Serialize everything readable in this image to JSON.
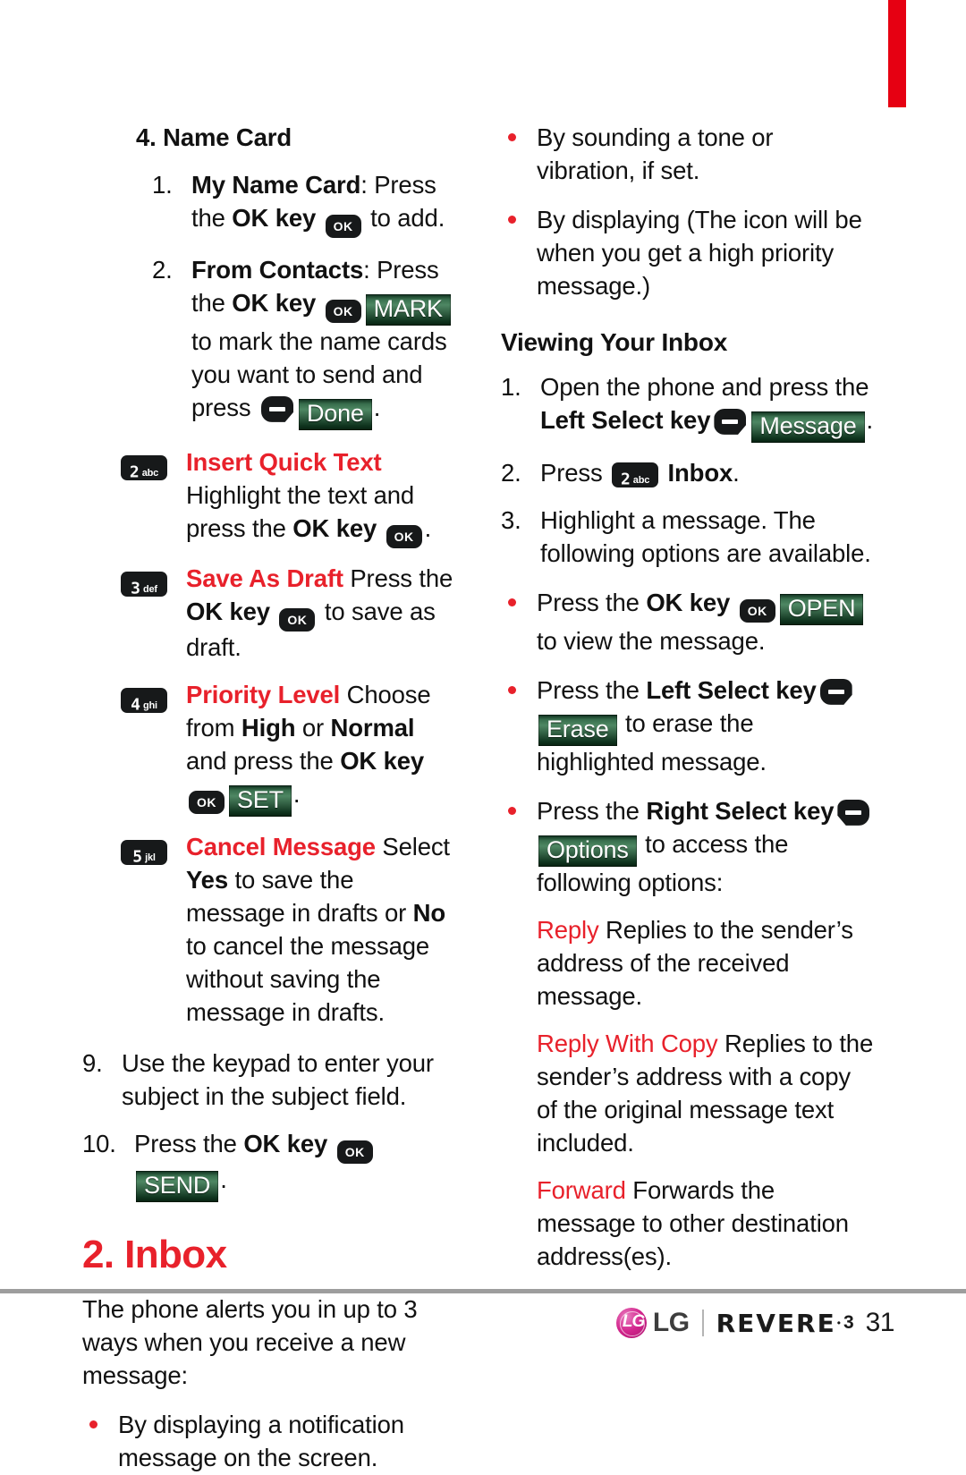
{
  "page": {
    "number": "31",
    "accent_red": "#e8212b",
    "tab_red": "#e60012",
    "green_button": "#2e5b3f"
  },
  "left_column": {
    "heading": "4. Name Card",
    "step1": {
      "marker": "1.",
      "term": "My Name Card",
      "text_a": ": Press the ",
      "term_b": "OK key",
      "key": "ok",
      "text_b": " to add."
    },
    "step2": {
      "marker": "2.",
      "term": "From Contacts",
      "text_a": ": Press the ",
      "term_b": "OK key",
      "key": "ok",
      "button": "MARK",
      "text_b": " to mark the name cards you want to send and press ",
      "softkey": "left-select",
      "button2": "Done",
      "text_c": "."
    },
    "keyed_items": [
      {
        "key_digit": "2",
        "key_letters": "abc",
        "title": "Insert Quick Text",
        "body_a": "Highlight the text and press the ",
        "bold_b": "OK key",
        "inline_key": "ok",
        "body_b": "."
      },
      {
        "key_digit": "3",
        "key_letters": "def",
        "title": "Save As Draft",
        "body_a": " Press the ",
        "bold_b": "OK key",
        "inline_key": "ok",
        "body_b": " to save as draft."
      },
      {
        "key_digit": "4",
        "key_letters": "ghi",
        "title": "Priority Level",
        "body_a": " Choose from ",
        "bold_1": "High",
        "body_mid": " or ",
        "bold_2": "Normal",
        "body_b": " and press the ",
        "bold_b": "OK key",
        "inline_key": "ok",
        "button": "SET",
        "body_c": "."
      },
      {
        "key_digit": "5",
        "key_letters": "jkl",
        "title": "Cancel Message",
        "body_a": " Select ",
        "bold_1": "Yes",
        "body_mid": " to save the message in drafts or ",
        "bold_2": "No",
        "body_b": " to cancel the message without saving the message in drafts."
      }
    ],
    "step9": {
      "marker": "9.",
      "text": "Use the keypad to enter your subject in the subject field."
    },
    "step10": {
      "marker": "10.",
      "text_a": "Press the ",
      "bold": "OK key",
      "key": "ok",
      "button": "SEND",
      "text_b": "."
    },
    "section_heading": "2. Inbox",
    "intro": "The phone alerts you in up to 3 ways when you receive a new message:",
    "bullets": [
      "By displaying a notification message on the screen."
    ]
  },
  "right_column": {
    "bullets_top": [
      "By sounding a tone or vibration, if set.",
      "By displaying (The icon will be when you get a high priority message.)"
    ],
    "heading": "Viewing Your Inbox",
    "step1": {
      "marker": "1.",
      "text_a": "Open the phone and press the ",
      "bold": "Left Select key",
      "softkey": "left-select",
      "button": "Message",
      "text_b": "."
    },
    "step2": {
      "marker": "2.",
      "text_a": "Press ",
      "key_digit": "2",
      "key_letters": "abc",
      "text_b": " ",
      "bold": "Inbox",
      "text_c": "."
    },
    "step3": {
      "marker": "3.",
      "text": "Highlight a message. The following options are available."
    },
    "bullets_options": [
      {
        "text_a": "Press the ",
        "bold": "OK key",
        "key": "ok",
        "button": "OPEN",
        "text_b": " to view the message."
      },
      {
        "text_a": "Press the ",
        "bold": "Left Select key",
        "softkey": "left-select",
        "button": "Erase",
        "text_b": " to erase the highlighted message."
      },
      {
        "text_a": "Press the ",
        "bold": "Right Select key",
        "softkey": "right-select",
        "button": "Options",
        "text_b": " to access the following options:"
      }
    ],
    "option_defs": [
      {
        "term": "Reply",
        "desc": " Replies to the sender’s address of the received message."
      },
      {
        "term": "Reply With Copy",
        "desc": " Replies to the sender’s address with a copy of the original message text included."
      },
      {
        "term": "Forward",
        "desc": " Forwards the message to other destination address(es)."
      }
    ]
  },
  "footer": {
    "brand": "LG",
    "product": "REVERE",
    "product_tm": "•",
    "product_gen": "3",
    "page_number": "31"
  }
}
